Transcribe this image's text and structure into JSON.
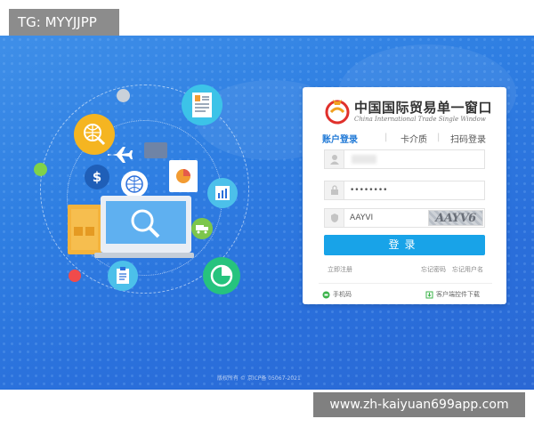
{
  "watermark_top": "TG: MYYJJPP",
  "watermark_bottom": "www.zh-kaiyuan699app.com",
  "brand": {
    "name_cn": "中国国际贸易单一窗口",
    "name_en": "China International Trade Single Window"
  },
  "tabs": [
    "账户登录",
    "卡介质",
    "扫码登录"
  ],
  "fields": {
    "username_value": "",
    "password_value": "••••••••",
    "captcha_value": "AAYVI",
    "captcha_image_text": "AAYV6"
  },
  "login_label": "登录",
  "links": {
    "register": "立即注册",
    "forgot_password": "忘记密码",
    "forgot_username": "忘记用户名"
  },
  "footer": {
    "mobile": "手机码",
    "client_download": "客户端控件下载"
  },
  "copyright": "版权所有 © 京ICP备 05067-2021",
  "colors": {
    "primary": "#18a3e8",
    "banner": "#2f7fe2",
    "tab_active": "#1e78d6"
  }
}
